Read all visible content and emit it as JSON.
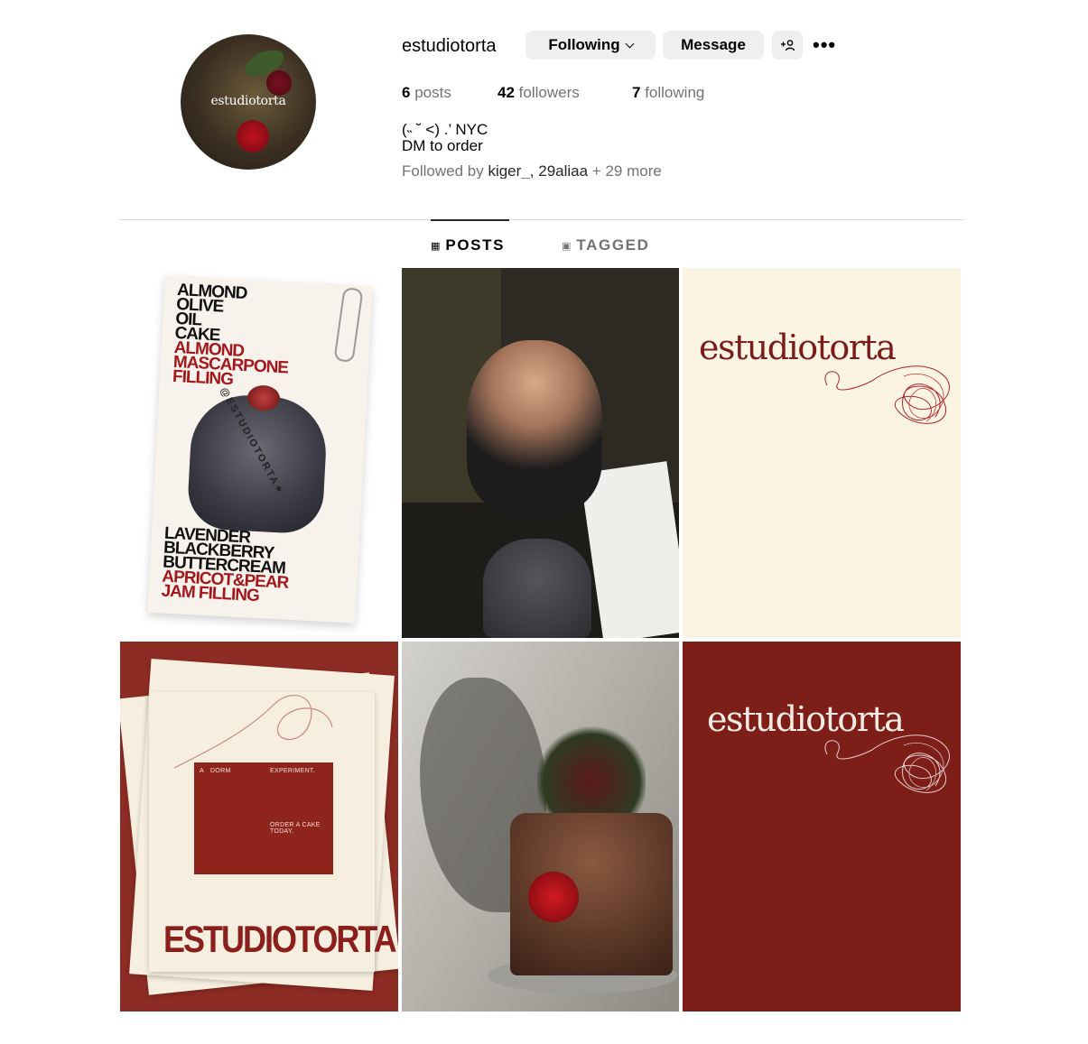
{
  "profile": {
    "avatar_text": "estudiotorta",
    "username": "estudiotorta",
    "following_label": "Following",
    "message_label": "Message",
    "add_user_label": "+👤",
    "more_label": "•••",
    "stats": {
      "posts_count": "6",
      "posts_label": "posts",
      "followers_count": "42",
      "followers_label": "followers",
      "following_count": "7",
      "following_label": "following"
    },
    "bio_line1": "(˵ ˘ ˂) .’ NYC",
    "bio_line2": "DM to order",
    "followed_by_prefix": "Followed by",
    "followed_by_user1": "kiger_",
    "followed_by_sep": ",",
    "followed_by_user2": "29aliaa",
    "followed_by_more": "+ 29 more"
  },
  "tabs": {
    "posts_icon": "▦",
    "posts_label": "POSTS",
    "tagged_icon": "▣",
    "tagged_label": "TAGGED"
  },
  "posts": {
    "p1": {
      "top_lines": [
        "ALMOND",
        "OLIVE",
        "OIL",
        "CAKE"
      ],
      "top_red_lines": [
        "ALMOND",
        "MASCARPONE",
        "FILLING"
      ],
      "handle": "@ESTUDIOTORTA★",
      "bottom_lines": [
        "LAVENDER",
        "BLACKBERRY",
        "BUTTERCREAM"
      ],
      "bottom_red_lines": [
        "APRICOT&PEAR",
        "JAM FILLING"
      ]
    },
    "p3": {
      "wordmark": "estudiotorta"
    },
    "p4": {
      "label_a": "A",
      "label_dorm": "DORM",
      "label_experiment": "EXPERIMENT.",
      "label_order": "ORDER A CAKE TODAY.",
      "brand": "ESTUDIOTORTA"
    },
    "p6": {
      "wordmark": "estudiotorta"
    }
  },
  "colors": {
    "brand_red": "#7d1e19",
    "cream": "#fbf4e3",
    "button_bg": "#efefef",
    "muted_text": "#737373"
  }
}
